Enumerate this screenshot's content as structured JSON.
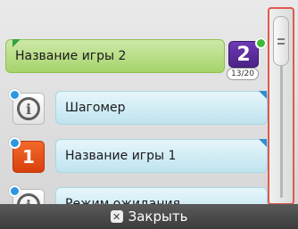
{
  "items": [
    {
      "label": "Название игры 2",
      "tile_text": "2",
      "counter": "13/20",
      "tile_icon": "game-2-icon"
    },
    {
      "label": "Шагомер",
      "tile_icon": "info-icon"
    },
    {
      "label": "Название игры 1",
      "tile_text": "1",
      "tile_icon": "game-1-icon"
    },
    {
      "label": "Режим ожидания",
      "tile_icon": "info-icon"
    }
  ],
  "footer": {
    "close_label": "Закрыть",
    "close_icon": "x-button-icon"
  },
  "colors": {
    "selected": "#a6d36b",
    "item": "#bfe3ef",
    "scroll_highlight": "#e2584a"
  }
}
